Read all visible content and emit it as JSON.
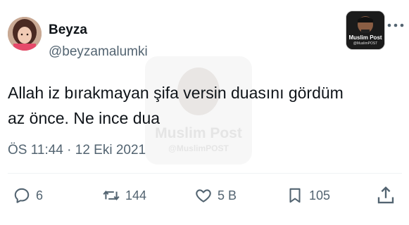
{
  "author": {
    "name": "Beyza",
    "handle": "@beyzamalumki"
  },
  "badge": {
    "title": "Muslim Post",
    "handle": "@MuslimPOST"
  },
  "tweet": {
    "line1": "Allah iz bırakmayan şifa versin duasını gördüm",
    "line2": "az önce. Ne ince dua",
    "meta": "ÖS 11:44 · 12 Eki 2021"
  },
  "watermark": {
    "title": "Muslim Post",
    "handle": "@MuslimPOST"
  },
  "actions": {
    "replies": "6",
    "retweets": "144",
    "likes": "5 B",
    "bookmarks": "105"
  },
  "icons": [
    "avatar",
    "more-icon",
    "reply-icon",
    "retweet-icon",
    "like-icon",
    "bookmark-icon",
    "share-icon"
  ],
  "colors": {
    "text": "#0f1419",
    "secondary": "#536471",
    "divider": "#eff3f4"
  }
}
